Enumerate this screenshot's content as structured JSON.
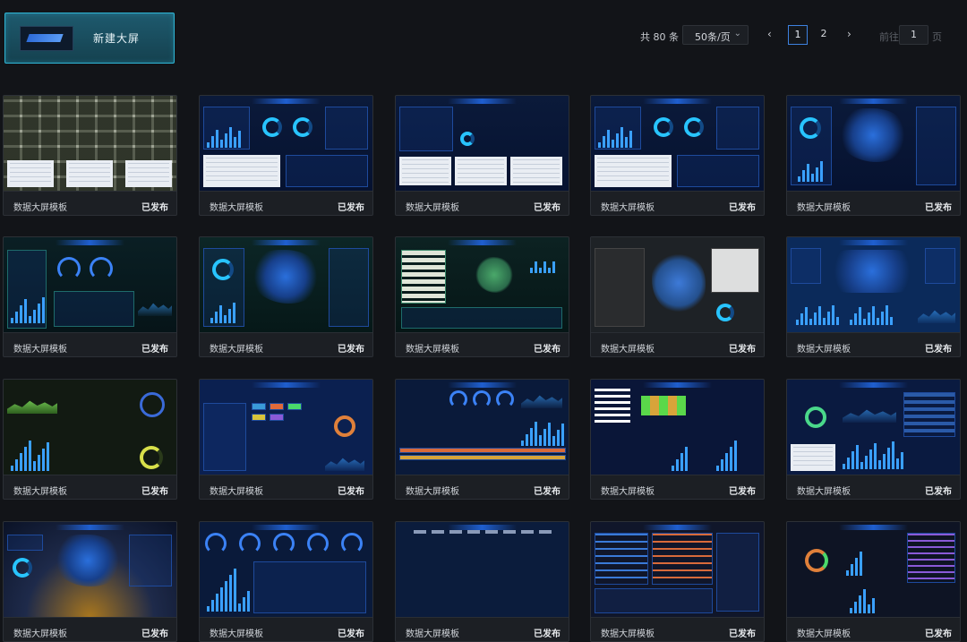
{
  "new_screen_button": {
    "label": "新建大屏"
  },
  "pagination": {
    "total_label": "共 80 条",
    "page_size": "50条/页",
    "prev_icon": "chevron-left",
    "pages": [
      "1",
      "2"
    ],
    "current_page": "1",
    "next_icon": "chevron-right",
    "goto_label": "前往",
    "goto_value": "1",
    "page_suffix": "页"
  },
  "templates": [
    {
      "name": "数据大屏模板",
      "status": "已发布",
      "theme": "satellite-map"
    },
    {
      "name": "数据大屏模板",
      "status": "已发布",
      "theme": "blue-dashboard"
    },
    {
      "name": "数据大屏模板",
      "status": "已发布",
      "theme": "blue-table"
    },
    {
      "name": "数据大屏模板",
      "status": "已发布",
      "theme": "blue-dashboard"
    },
    {
      "name": "数据大屏模板",
      "status": "已发布",
      "theme": "china-map"
    },
    {
      "name": "数据大屏模板",
      "status": "已发布",
      "theme": "teal-gauges"
    },
    {
      "name": "数据大屏模板",
      "status": "已发布",
      "theme": "teal-map"
    },
    {
      "name": "数据大屏模板",
      "status": "已发布",
      "theme": "teal-list"
    },
    {
      "name": "数据大屏模板",
      "status": "已发布",
      "theme": "gray-map"
    },
    {
      "name": "数据大屏模板",
      "status": "已发布",
      "theme": "world-map"
    },
    {
      "name": "数据大屏模板",
      "status": "已发布",
      "theme": "green-charts"
    },
    {
      "name": "数据大屏模板",
      "status": "已发布",
      "theme": "blue-tiles"
    },
    {
      "name": "数据大屏模板",
      "status": "已发布",
      "theme": "blue-gauges"
    },
    {
      "name": "数据大屏模板",
      "status": "已发布",
      "theme": "blue-bars"
    },
    {
      "name": "数据大屏模板",
      "status": "已发布",
      "theme": "blue-mixed"
    },
    {
      "name": "数据大屏模板",
      "status": "已发布",
      "theme": "night-map"
    },
    {
      "name": "数据大屏模板",
      "status": "已发布",
      "theme": "gauge-row"
    },
    {
      "name": "数据大屏模板",
      "status": "已发布",
      "theme": "blank"
    },
    {
      "name": "数据大屏模板",
      "status": "已发布",
      "theme": "dc-progress"
    },
    {
      "name": "数据大屏模板",
      "status": "已发布",
      "theme": "dc-overview"
    }
  ],
  "colors": {
    "accent": "#3d82e0",
    "button_border": "#2fb6d6",
    "background": "#121418",
    "card": "#1c1f24"
  }
}
